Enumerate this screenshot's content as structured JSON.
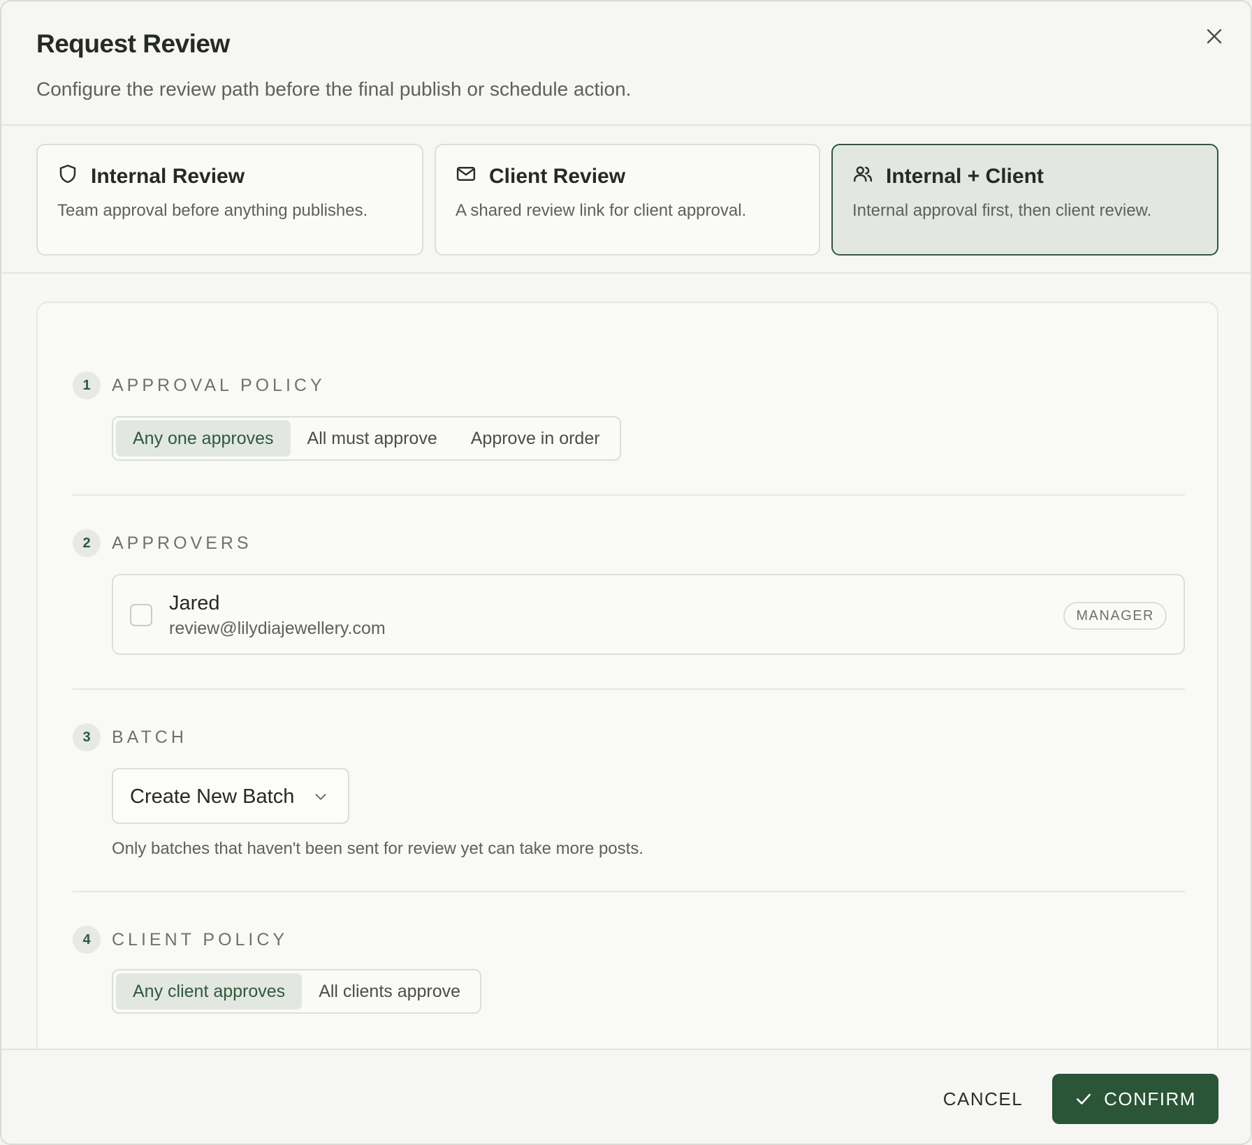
{
  "dialog": {
    "title": "Request Review",
    "subtitle": "Configure the review path before the final publish or schedule action."
  },
  "modes": [
    {
      "title": "Internal Review",
      "description": "Team approval before anything publishes.",
      "icon": "shield-icon",
      "selected": false
    },
    {
      "title": "Client Review",
      "description": "A shared review link for client approval.",
      "icon": "mail-icon",
      "selected": false
    },
    {
      "title": "Internal + Client",
      "description": "Internal approval first, then client review.",
      "icon": "users-icon",
      "selected": true
    }
  ],
  "sections": {
    "approval_policy": {
      "number": "1",
      "label": "APPROVAL POLICY",
      "options": [
        "Any one approves",
        "All must approve",
        "Approve in order"
      ],
      "selected": "Any one approves"
    },
    "approvers": {
      "number": "2",
      "label": "APPROVERS",
      "items": [
        {
          "name": "Jared",
          "email": "review@lilydiajewellery.com",
          "role": "MANAGER",
          "checked": false
        }
      ]
    },
    "batch": {
      "number": "3",
      "label": "BATCH",
      "selected": "Create New Batch",
      "help": "Only batches that haven't been sent for review yet can take more posts."
    },
    "client_policy": {
      "number": "4",
      "label": "CLIENT POLICY",
      "options": [
        "Any client approves",
        "All clients approve"
      ],
      "selected": "Any client approves"
    }
  },
  "footer": {
    "cancel_label": "CANCEL",
    "confirm_label": "CONFIRM"
  },
  "colors": {
    "accent": "#2a5536",
    "selected_bg": "#e3e7e2",
    "border": "#dcdeda"
  }
}
